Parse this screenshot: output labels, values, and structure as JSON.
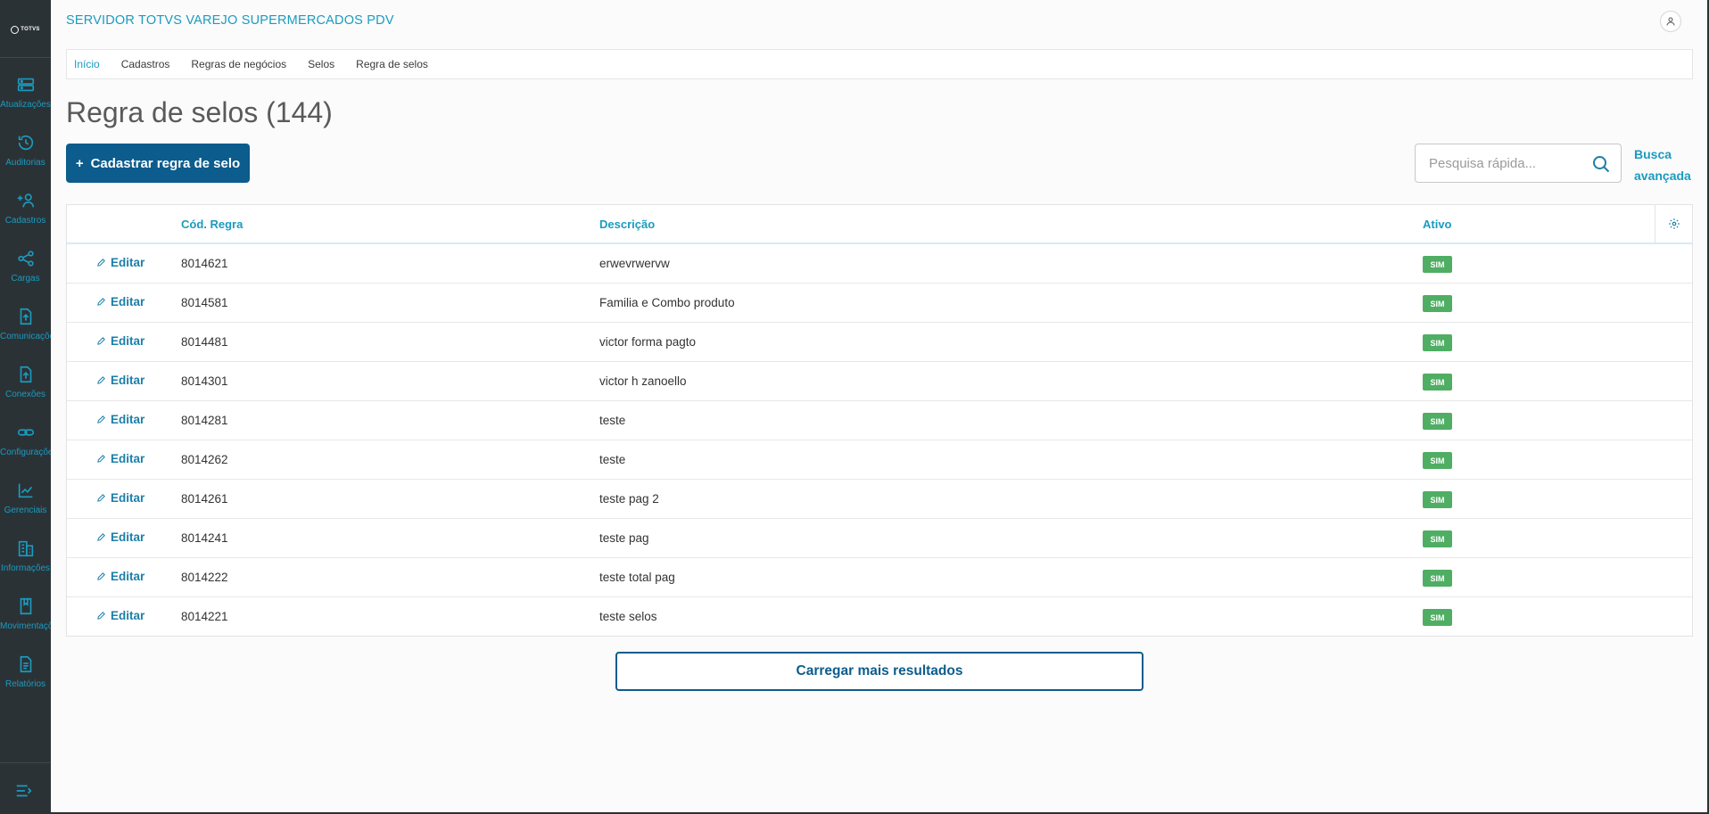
{
  "app": {
    "title": "SERVIDOR TOTVS VAREJO SUPERMERCADOS PDV",
    "logo_text": "TOTVS"
  },
  "sidebar": {
    "items": [
      {
        "label": "Atualizações",
        "icon": "server-icon"
      },
      {
        "label": "Auditorias",
        "icon": "history-icon"
      },
      {
        "label": "Cadastros",
        "icon": "add-user-icon"
      },
      {
        "label": "Cargas",
        "icon": "share-icon"
      },
      {
        "label": "Comunicações",
        "icon": "upload-file-icon"
      },
      {
        "label": "Conexões",
        "icon": "upload-file-icon"
      },
      {
        "label": "Configurações",
        "icon": "link-icon"
      },
      {
        "label": "Gerenciais",
        "icon": "chart-icon"
      },
      {
        "label": "Informações",
        "icon": "building-icon"
      },
      {
        "label": "Movimentações",
        "icon": "bookmark-icon"
      },
      {
        "label": "Relatórios",
        "icon": "document-icon"
      }
    ]
  },
  "breadcrumb": [
    "Início",
    "Cadastros",
    "Regras de negócios",
    "Selos",
    "Regra de selos"
  ],
  "page": {
    "title": "Regra de selos (144)",
    "add_button": "Cadastrar regra de selo",
    "add_button_plus": "+",
    "search_placeholder": "Pesquisa rápida...",
    "advanced_search_line1": "Busca",
    "advanced_search_line2": "avançada",
    "load_more": "Carregar mais resultados"
  },
  "table": {
    "columns": [
      "Cód. Regra",
      "Descrição",
      "Ativo"
    ],
    "edit_label": "Editar",
    "rows": [
      {
        "code": "8014621",
        "description": "erwevrwervw",
        "active": "SIM"
      },
      {
        "code": "8014581",
        "description": "Familia e Combo produto",
        "active": "SIM"
      },
      {
        "code": "8014481",
        "description": "victor forma pagto",
        "active": "SIM"
      },
      {
        "code": "8014301",
        "description": "victor h zanoello",
        "active": "SIM"
      },
      {
        "code": "8014281",
        "description": "teste",
        "active": "SIM"
      },
      {
        "code": "8014262",
        "description": "teste",
        "active": "SIM"
      },
      {
        "code": "8014261",
        "description": "teste pag 2",
        "active": "SIM"
      },
      {
        "code": "8014241",
        "description": "teste pag",
        "active": "SIM"
      },
      {
        "code": "8014222",
        "description": "teste total pag",
        "active": "SIM"
      },
      {
        "code": "8014221",
        "description": "teste selos",
        "active": "SIM"
      }
    ]
  },
  "colors": {
    "sidebar_bg": "#2b3236",
    "accent": "#1b9bbf",
    "primary": "#0c5c8d",
    "badge_green": "#4fae63"
  }
}
